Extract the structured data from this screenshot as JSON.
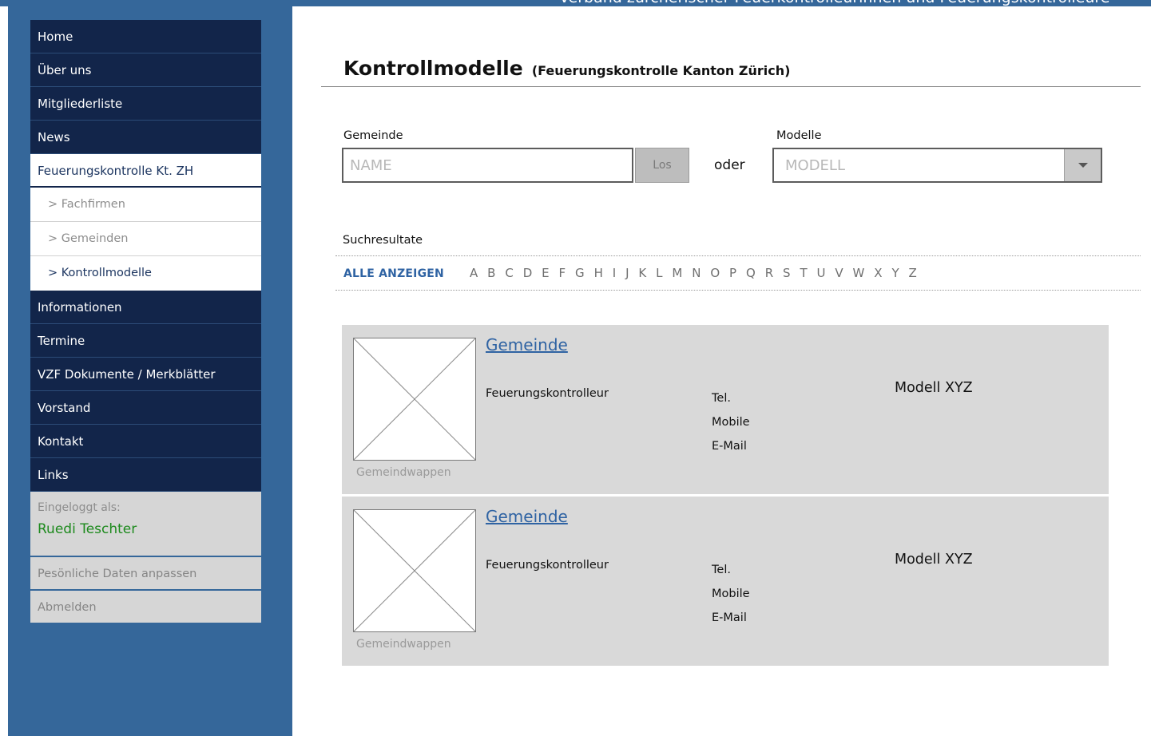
{
  "header": {
    "title": "Verband zürcherischer Feuerkontrolleurinnen und Feuerungskontrolleure"
  },
  "sidebar": {
    "items": [
      {
        "label": "Home"
      },
      {
        "label": "Über uns"
      },
      {
        "label": "Mitgliederliste"
      },
      {
        "label": "News"
      },
      {
        "label": "Feuerungskontrolle Kt. ZH",
        "active": true
      },
      {
        "label": "> Fachfirmen"
      },
      {
        "label": "> Gemeinden"
      },
      {
        "label": "> Kontrollmodelle",
        "current": true
      },
      {
        "label": "Informationen"
      },
      {
        "label": "Termine"
      },
      {
        "label": "VZF Dokumente / Merkblätter"
      },
      {
        "label": "Vorstand"
      },
      {
        "label": "Kontakt"
      },
      {
        "label": "Links"
      }
    ],
    "login": {
      "label": "Eingeloggt als:",
      "user": "Ruedi Teschter",
      "edit_label": "Pesönliche Daten anpassen",
      "logout_label": "Abmelden"
    }
  },
  "main": {
    "title": "Kontrollmodelle",
    "subtitle": "(Feuerungskontrolle Kanton Zürich)",
    "search": {
      "gemeinde_label": "Gemeinde",
      "name_placeholder": "NAME",
      "go_label": "Los",
      "or_label": "oder",
      "modelle_label": "Modelle",
      "modell_value": "MODELL"
    },
    "results_label": "Suchresultate",
    "show_all_label": "ALLE ANZEIGEN",
    "letters": [
      "A",
      "B",
      "C",
      "D",
      "E",
      "F",
      "G",
      "H",
      "I",
      "J",
      "K",
      "L",
      "M",
      "N",
      "O",
      "P",
      "Q",
      "R",
      "S",
      "T",
      "U",
      "V",
      "W",
      "X",
      "Y",
      "Z"
    ],
    "results": [
      {
        "gemeinde": "Gemeinde",
        "wappen_caption": "Gemeindwappen",
        "kontrolleur": "Feuerungskontrolleur",
        "tel": "Tel.",
        "mobile": "Mobile",
        "email": "E-Mail",
        "modell": "Modell XYZ"
      },
      {
        "gemeinde": "Gemeinde",
        "wappen_caption": "Gemeindwappen",
        "kontrolleur": "Feuerungskontrolleur",
        "tel": "Tel.",
        "mobile": "Mobile",
        "email": "E-Mail",
        "modell": "Modell XYZ"
      }
    ]
  },
  "colors": {
    "background_band": "#35679a",
    "nav_dark": "#12254a",
    "link_blue": "#2f63a3",
    "user_green": "#1d8a1d",
    "card_gray": "#d9d9d9"
  }
}
